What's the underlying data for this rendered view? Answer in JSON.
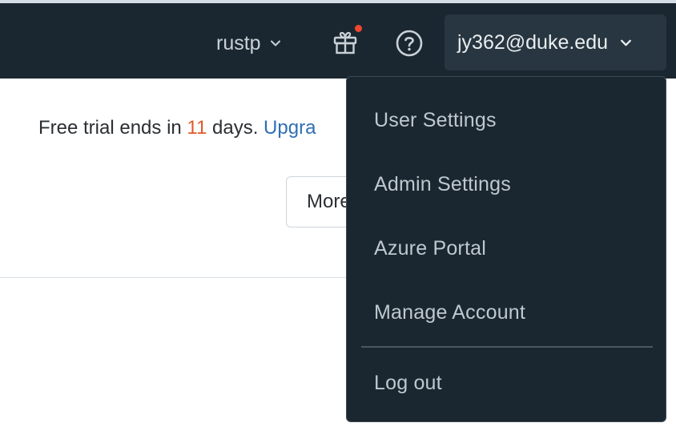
{
  "header": {
    "workspace_name": "rustp",
    "account_email": "jy362@duke.edu",
    "notification_color": "#f0462e"
  },
  "banner": {
    "trial_prefix": "Free trial ends in ",
    "trial_days": "11",
    "trial_suffix": " days. ",
    "upgrade_label": "Upgra",
    "more_button_label": "More"
  },
  "account_menu": {
    "items": [
      {
        "label": "User Settings"
      },
      {
        "label": "Admin Settings"
      },
      {
        "label": "Azure Portal"
      },
      {
        "label": "Manage Account"
      },
      {
        "label": "Log out"
      }
    ]
  },
  "icons": {
    "workspace_chevron": "chevron-down-icon",
    "gift": "gift-icon",
    "help": "help-icon",
    "account_chevron": "chevron-down-icon"
  }
}
